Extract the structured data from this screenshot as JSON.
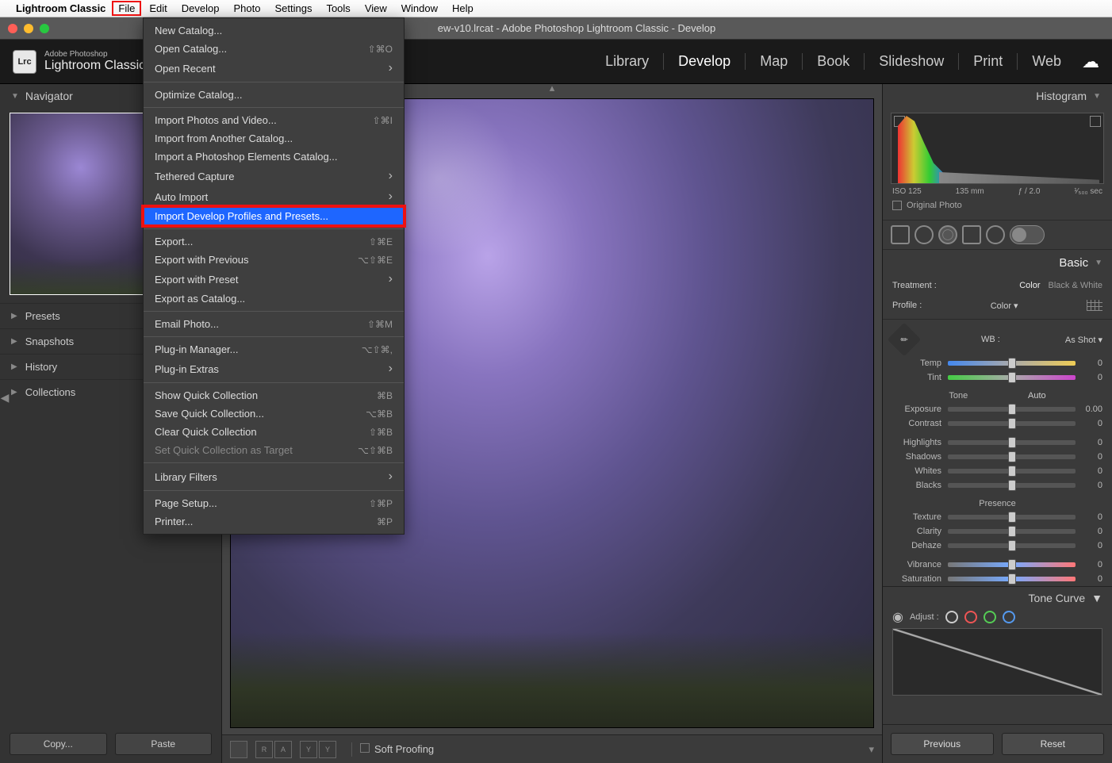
{
  "menubar": {
    "app": "Lightroom Classic",
    "items": [
      "File",
      "Edit",
      "Develop",
      "Photo",
      "Settings",
      "Tools",
      "View",
      "Window",
      "Help"
    ]
  },
  "window_title": "ew-v10.lrcat - Adobe Photoshop Lightroom Classic - Develop",
  "logo": {
    "badge": "Lrc",
    "small": "Adobe Photoshop",
    "big": "Lightroom Classic"
  },
  "modules": [
    "Library",
    "Develop",
    "Map",
    "Book",
    "Slideshow",
    "Print",
    "Web"
  ],
  "active_module": "Develop",
  "left_panels": {
    "navigator": "Navigator",
    "presets": "Presets",
    "snapshots": "Snapshots",
    "history": "History",
    "collections": "Collections"
  },
  "left_buttons": {
    "copy": "Copy...",
    "paste": "Paste"
  },
  "toolbar": {
    "soft_proof": "Soft Proofing"
  },
  "right": {
    "histogram": "Histogram",
    "meta": {
      "iso": "ISO 125",
      "focal": "135 mm",
      "ap": "ƒ / 2.0",
      "sh": "¹⁄₅₀₀ sec"
    },
    "original": "Original Photo",
    "basic": "Basic",
    "treatment": "Treatment :",
    "color": "Color",
    "bw": "Black & White",
    "profile_label": "Profile :",
    "profile_value": "Color",
    "wb_label": "WB :",
    "wb_value": "As Shot",
    "sliders": {
      "temp": {
        "label": "Temp",
        "val": "0"
      },
      "tint": {
        "label": "Tint",
        "val": "0"
      },
      "tone": "Tone",
      "auto": "Auto",
      "exposure": {
        "label": "Exposure",
        "val": "0.00"
      },
      "contrast": {
        "label": "Contrast",
        "val": "0"
      },
      "highlights": {
        "label": "Highlights",
        "val": "0"
      },
      "shadows": {
        "label": "Shadows",
        "val": "0"
      },
      "whites": {
        "label": "Whites",
        "val": "0"
      },
      "blacks": {
        "label": "Blacks",
        "val": "0"
      },
      "presence": "Presence",
      "texture": {
        "label": "Texture",
        "val": "0"
      },
      "clarity": {
        "label": "Clarity",
        "val": "0"
      },
      "dehaze": {
        "label": "Dehaze",
        "val": "0"
      },
      "vibrance": {
        "label": "Vibrance",
        "val": "0"
      },
      "saturation": {
        "label": "Saturation",
        "val": "0"
      }
    },
    "tone_curve": "Tone Curve",
    "adjust": "Adjust :"
  },
  "right_buttons": {
    "prev": "Previous",
    "reset": "Reset"
  },
  "file_menu": [
    {
      "t": "item",
      "label": "New Catalog..."
    },
    {
      "t": "item",
      "label": "Open Catalog...",
      "sc": "⇧⌘O"
    },
    {
      "t": "sub",
      "label": "Open Recent"
    },
    {
      "t": "sep"
    },
    {
      "t": "item",
      "label": "Optimize Catalog..."
    },
    {
      "t": "sep"
    },
    {
      "t": "item",
      "label": "Import Photos and Video...",
      "sc": "⇧⌘I"
    },
    {
      "t": "item",
      "label": "Import from Another Catalog..."
    },
    {
      "t": "item",
      "label": "Import a Photoshop Elements Catalog..."
    },
    {
      "t": "sub",
      "label": "Tethered Capture"
    },
    {
      "t": "sub",
      "label": "Auto Import"
    },
    {
      "t": "hl",
      "label": "Import Develop Profiles and Presets..."
    },
    {
      "t": "sep"
    },
    {
      "t": "item",
      "label": "Export...",
      "sc": "⇧⌘E"
    },
    {
      "t": "item",
      "label": "Export with Previous",
      "sc": "⌥⇧⌘E"
    },
    {
      "t": "sub",
      "label": "Export with Preset"
    },
    {
      "t": "item",
      "label": "Export as Catalog..."
    },
    {
      "t": "sep"
    },
    {
      "t": "item",
      "label": "Email Photo...",
      "sc": "⇧⌘M"
    },
    {
      "t": "sep"
    },
    {
      "t": "item",
      "label": "Plug-in Manager...",
      "sc": "⌥⇧⌘,"
    },
    {
      "t": "sub",
      "label": "Plug-in Extras"
    },
    {
      "t": "sep"
    },
    {
      "t": "item",
      "label": "Show Quick Collection",
      "sc": "⌘B"
    },
    {
      "t": "item",
      "label": "Save Quick Collection...",
      "sc": "⌥⌘B"
    },
    {
      "t": "item",
      "label": "Clear Quick Collection",
      "sc": "⇧⌘B"
    },
    {
      "t": "dis",
      "label": "Set Quick Collection as Target",
      "sc": "⌥⇧⌘B"
    },
    {
      "t": "sep"
    },
    {
      "t": "sub",
      "label": "Library Filters"
    },
    {
      "t": "sep"
    },
    {
      "t": "item",
      "label": "Page Setup...",
      "sc": "⇧⌘P"
    },
    {
      "t": "item",
      "label": "Printer...",
      "sc": "⌘P"
    }
  ]
}
